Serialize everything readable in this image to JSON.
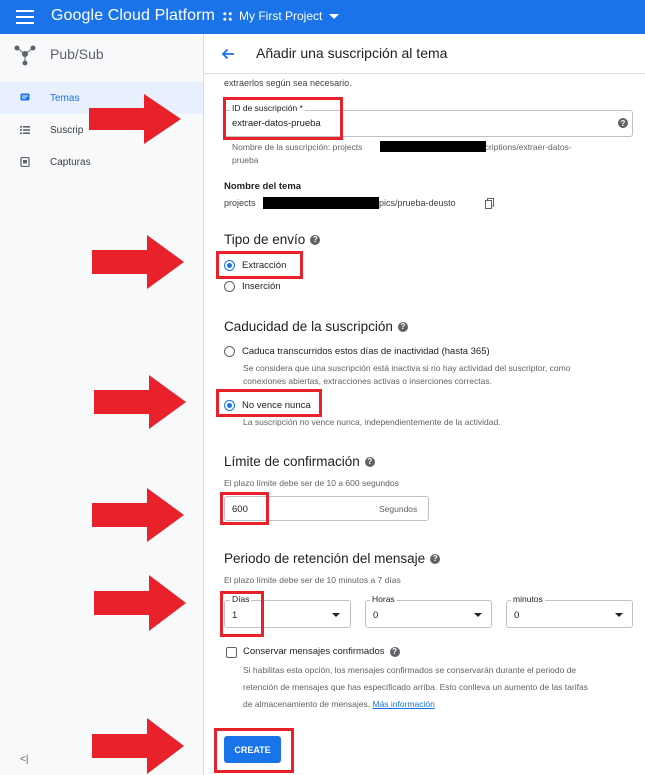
{
  "topbar": {
    "brand": "Google Cloud Platform",
    "project": "My First Project"
  },
  "sidebar": {
    "title": "Pub/Sub",
    "items": [
      {
        "label": "Temas"
      },
      {
        "label": "Suscrip"
      },
      {
        "label": "Capturas"
      }
    ],
    "collapse": "<|"
  },
  "header": {
    "title": "Añadir una suscripción al tema"
  },
  "content": {
    "intro": "extraerlos según sea necesario.",
    "sub_id": {
      "label": "ID de suscripción *",
      "value": "extraer-datos-prueba",
      "hint_pre": "Nombre de la suscripción: projects",
      "hint_post": "/subscriptions/extraer-datos-",
      "hint_end": "prueba"
    },
    "topic": {
      "label": "Nombre del tema",
      "pre": "projects",
      "post": "topics/prueba-deusto"
    },
    "delivery": {
      "title": "Tipo de envío",
      "opt1": "Extracción",
      "opt2": "Inserción"
    },
    "expiry": {
      "title": "Caducidad de la suscripción",
      "opt1": "Caduca transcurridos estos días de inactividad (hasta 365)",
      "opt1_hint1": "Se considera que una suscripción está inactiva si no hay actividad del suscriptor, como",
      "opt1_hint2": "conexiones abiertas, extracciones activas o inserciones correctas.",
      "opt2": "No vence nunca",
      "opt2_hint": "La suscripción no vence nunca, independientemente de la actividad."
    },
    "ack": {
      "title": "Límite de confirmación",
      "hint": "El plazo límite debe ser de 10 a 600 segundos",
      "value": "600",
      "suffix": "Segundos"
    },
    "retention": {
      "title": "Periodo de retención del mensaje",
      "hint": "El plazo límite debe ser de 10 minutos a 7 días",
      "days_label": "Días",
      "days_value": "1",
      "hours_label": "Horas",
      "hours_value": "0",
      "minutes_label": "minutos",
      "minutes_value": "0"
    },
    "retain": {
      "label": "Conservar mensajes confirmados",
      "hint1": "Si habilitas esta opción, los mensajes confirmados se conservarán durante el periodo de",
      "hint2": "retención de mensajes que has especificado arriba. Esto conlleva un aumento de las tarifas",
      "hint3": "de almacenamiento de mensajes.",
      "link": "Más información"
    },
    "create_label": "CREATE"
  },
  "colors": {
    "primary": "#1a73e8",
    "annotation": "#e8212b"
  }
}
